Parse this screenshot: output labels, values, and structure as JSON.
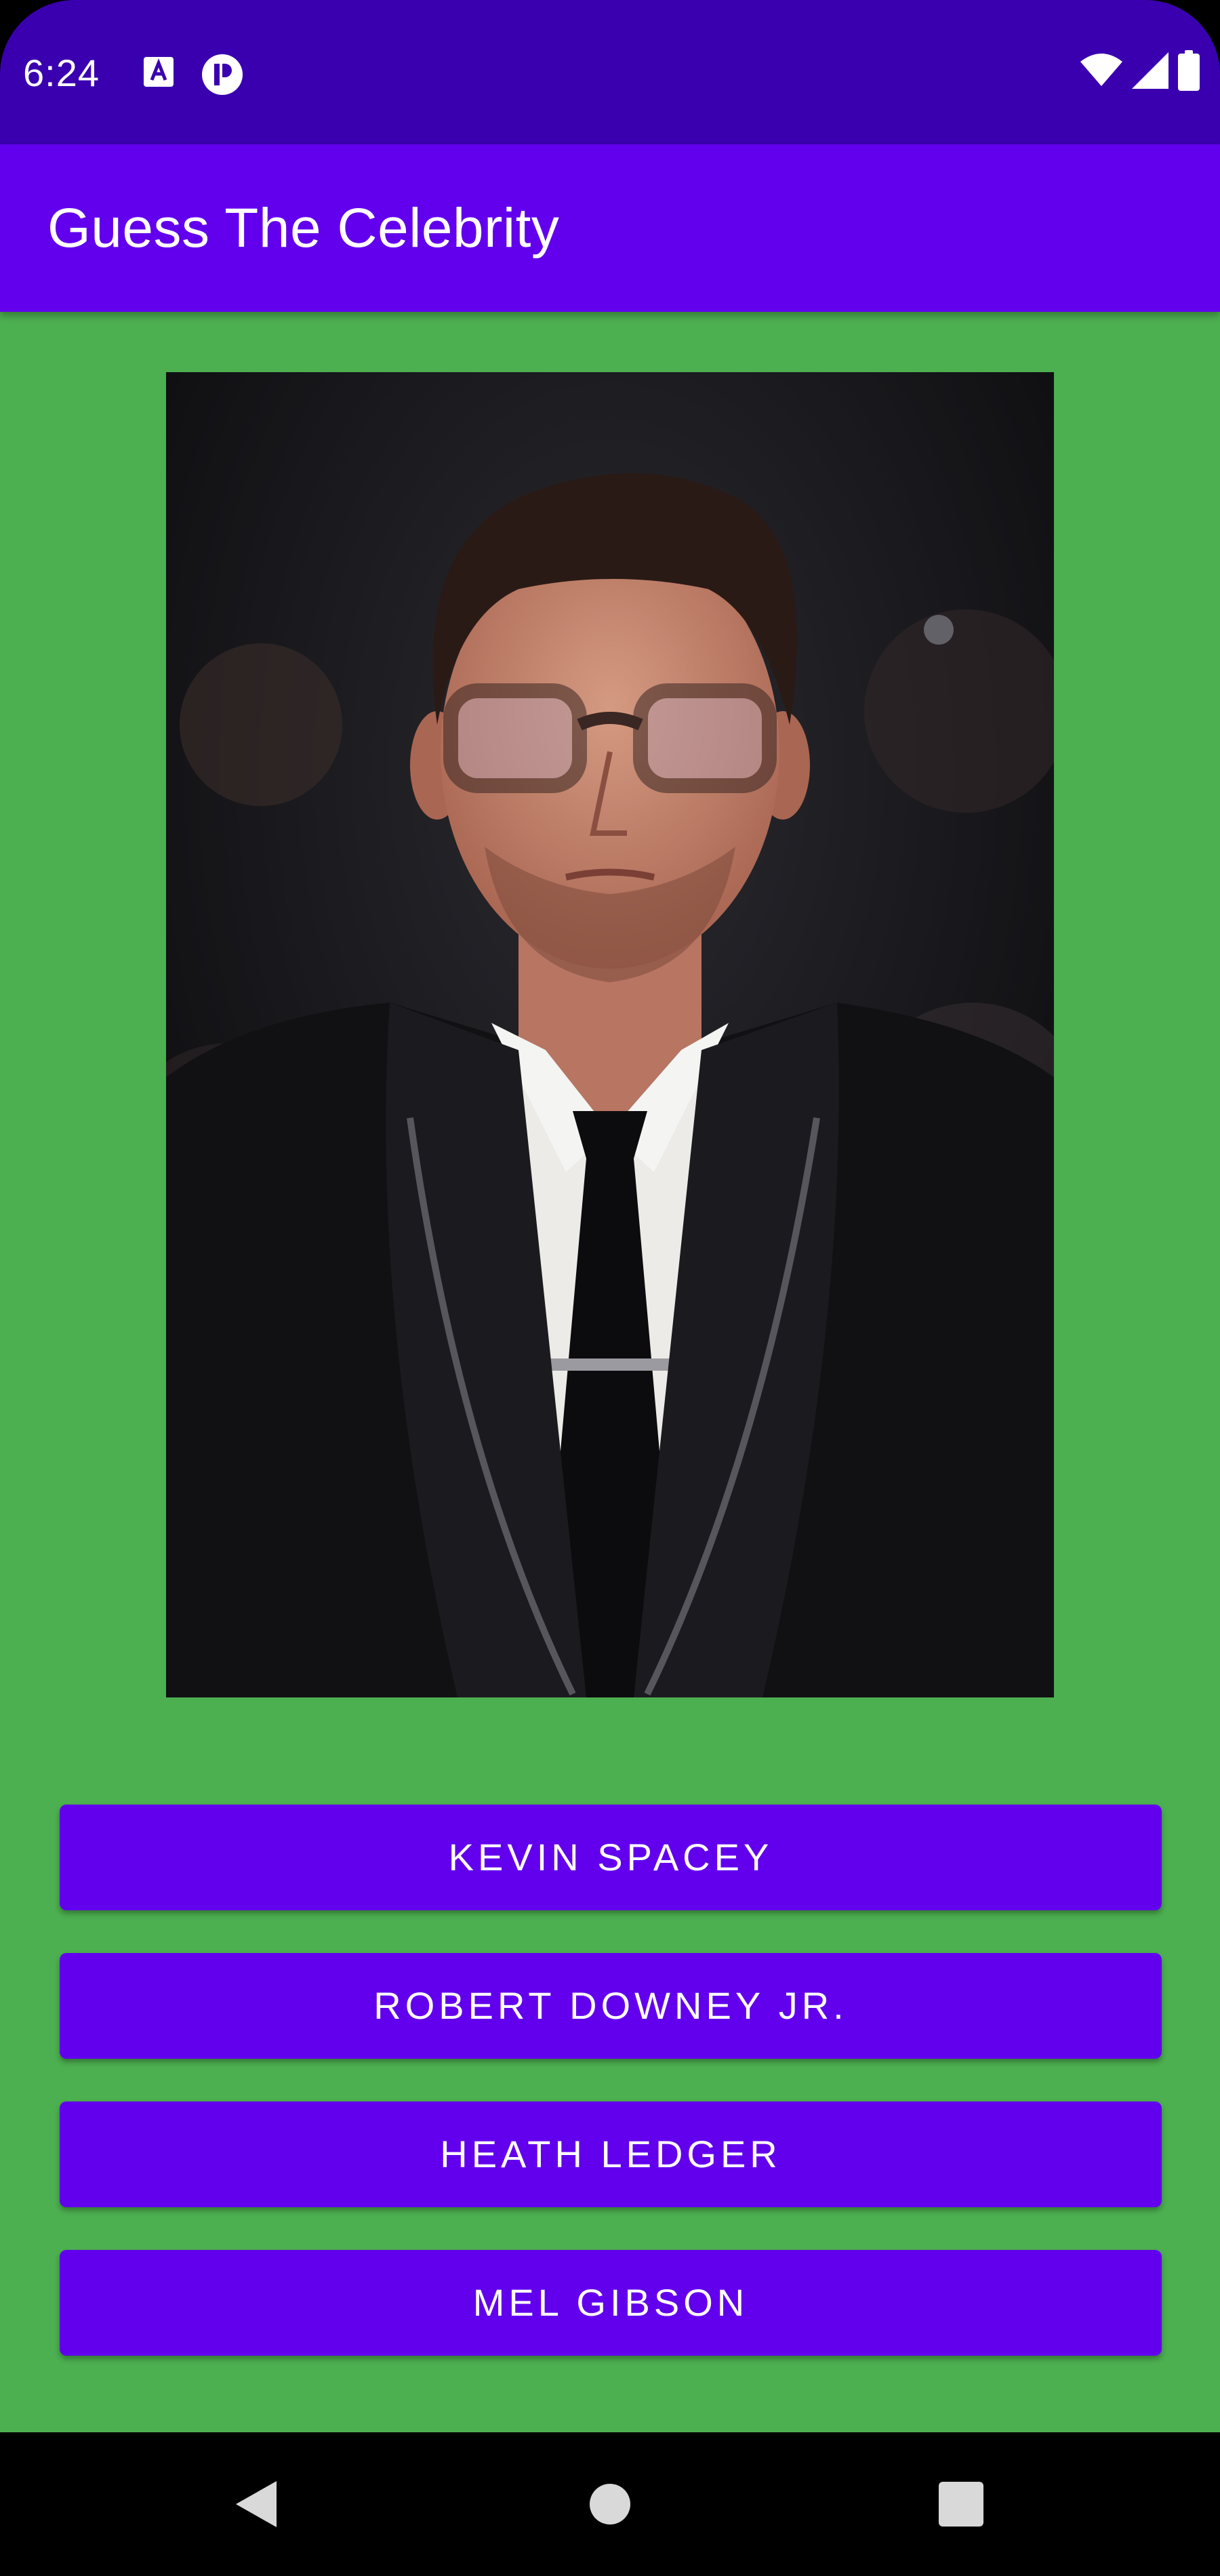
{
  "status_bar": {
    "time": "6:24",
    "notification_icons": [
      "text-a-icon",
      "circle-p-icon"
    ],
    "system_icons": [
      "wifi-icon",
      "signal-icon",
      "battery-icon"
    ]
  },
  "app_bar": {
    "title": "Guess The Celebrity"
  },
  "quiz": {
    "photo_icon": "celebrity-photo",
    "answers": [
      {
        "label": "KEVIN SPACEY"
      },
      {
        "label": "ROBERT DOWNEY JR."
      },
      {
        "label": "HEATH LEDGER"
      },
      {
        "label": "MEL GIBSON"
      }
    ]
  },
  "nav_bar": {
    "buttons": [
      "back-icon",
      "home-icon",
      "recents-icon"
    ]
  },
  "colors": {
    "status_bar": "#3a00b0",
    "app_bar": "#6200ee",
    "background": "#4caf50",
    "button": "#6200ee",
    "button_text": "#ffffff"
  }
}
